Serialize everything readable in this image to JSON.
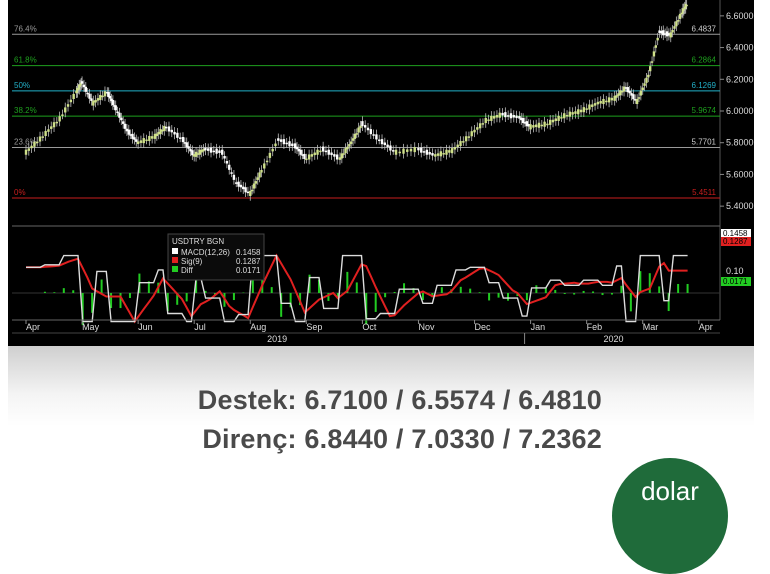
{
  "chart_data": {
    "type": "line",
    "instrument": "USDTRY BGN",
    "ylim": [
      5.3,
      6.7
    ],
    "y_ticks": [
      "6.6000",
      "6.4000",
      "6.2000",
      "6.0000",
      "5.8000",
      "5.6000",
      "5.4000"
    ],
    "x_ticks": [
      "Apr",
      "May",
      "Jun",
      "Jul",
      "Aug",
      "Sep",
      "Oct",
      "Nov",
      "Dec",
      "Jan",
      "Feb",
      "Mar",
      "Apr"
    ],
    "years": [
      "2019",
      "2020"
    ],
    "fib_levels": [
      {
        "label": "76.4%",
        "value": 6.4837,
        "value_label": "6.4837",
        "color": "#9a9a9a"
      },
      {
        "label": "61.8%",
        "value": 6.2864,
        "value_label": "6.2864",
        "color": "#1ea01e"
      },
      {
        "label": "50%",
        "value": 6.1269,
        "value_label": "6.1269",
        "color": "#22b0c8"
      },
      {
        "label": "38.2%",
        "value": 5.9674,
        "value_label": "5.9674",
        "color": "#1ea01e"
      },
      {
        "label": "23.6%",
        "value": 5.7701,
        "value_label": "5.7701",
        "color": "#9a9a9a"
      },
      {
        "label": "0%",
        "value": 5.4511,
        "value_label": "5.4511",
        "color": "#c81e1e"
      }
    ],
    "price_series": [
      {
        "t": 0,
        "v": 5.74
      },
      {
        "t": 0.3,
        "v": 5.84
      },
      {
        "t": 0.6,
        "v": 5.95
      },
      {
        "t": 0.9,
        "v": 6.12
      },
      {
        "t": 1.0,
        "v": 6.18
      },
      {
        "t": 1.2,
        "v": 6.05
      },
      {
        "t": 1.45,
        "v": 6.12
      },
      {
        "t": 1.6,
        "v": 6.02
      },
      {
        "t": 1.8,
        "v": 5.88
      },
      {
        "t": 2.0,
        "v": 5.8
      },
      {
        "t": 2.3,
        "v": 5.84
      },
      {
        "t": 2.5,
        "v": 5.9
      },
      {
        "t": 2.8,
        "v": 5.82
      },
      {
        "t": 3.0,
        "v": 5.72
      },
      {
        "t": 3.2,
        "v": 5.76
      },
      {
        "t": 3.5,
        "v": 5.74
      },
      {
        "t": 3.75,
        "v": 5.55
      },
      {
        "t": 4.0,
        "v": 5.48
      },
      {
        "t": 4.2,
        "v": 5.62
      },
      {
        "t": 4.5,
        "v": 5.82
      },
      {
        "t": 4.8,
        "v": 5.78
      },
      {
        "t": 5.0,
        "v": 5.7
      },
      {
        "t": 5.3,
        "v": 5.76
      },
      {
        "t": 5.6,
        "v": 5.7
      },
      {
        "t": 5.8,
        "v": 5.8
      },
      {
        "t": 6.0,
        "v": 5.92
      },
      {
        "t": 6.3,
        "v": 5.82
      },
      {
        "t": 6.6,
        "v": 5.74
      },
      {
        "t": 7.0,
        "v": 5.76
      },
      {
        "t": 7.3,
        "v": 5.72
      },
      {
        "t": 7.6,
        "v": 5.75
      },
      {
        "t": 7.9,
        "v": 5.84
      },
      {
        "t": 8.2,
        "v": 5.94
      },
      {
        "t": 8.5,
        "v": 5.98
      },
      {
        "t": 8.8,
        "v": 5.96
      },
      {
        "t": 9.0,
        "v": 5.9
      },
      {
        "t": 9.3,
        "v": 5.92
      },
      {
        "t": 9.6,
        "v": 5.97
      },
      {
        "t": 9.9,
        "v": 6.0
      },
      {
        "t": 10.2,
        "v": 6.05
      },
      {
        "t": 10.5,
        "v": 6.08
      },
      {
        "t": 10.7,
        "v": 6.15
      },
      {
        "t": 10.9,
        "v": 6.06
      },
      {
        "t": 11.1,
        "v": 6.22
      },
      {
        "t": 11.3,
        "v": 6.5
      },
      {
        "t": 11.5,
        "v": 6.48
      },
      {
        "t": 11.7,
        "v": 6.62
      },
      {
        "t": 11.8,
        "v": 6.68
      }
    ],
    "macd_panel": {
      "legend_title": "USDTRY BGN",
      "series": [
        {
          "name": "MACD(12,26)",
          "value": "0.1458",
          "color": "#ffffff"
        },
        {
          "name": "Sig(9)",
          "value": "0.1287",
          "color": "#e02020"
        },
        {
          "name": "Diff",
          "value": "0.0171",
          "color": "#22cc22"
        }
      ],
      "y_tick": "0.10",
      "right_labels": [
        "0.1458",
        "0.1287",
        "0.0171"
      ]
    }
  },
  "caption": {
    "support": "Destek: 6.7100 / 6.5574 / 6.4810",
    "resistance": "Direnç: 6.8440 / 7.0330 / 7.2362"
  },
  "logo": {
    "text": "dolar"
  }
}
